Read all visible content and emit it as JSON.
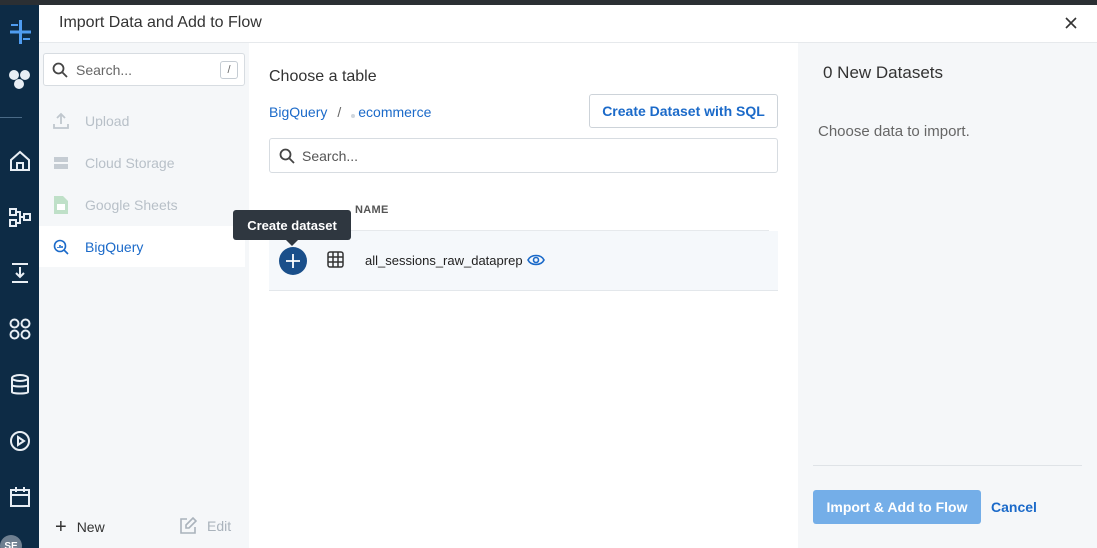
{
  "modal": {
    "title": "Import Data and Add to Flow"
  },
  "sidebar": {
    "search_placeholder": "Search...",
    "search_shortcut": "/",
    "items": [
      {
        "label": "Upload",
        "icon": "upload-icon",
        "state": "disabled"
      },
      {
        "label": "Cloud Storage",
        "icon": "cloud-storage-icon",
        "state": "disabled"
      },
      {
        "label": "Google Sheets",
        "icon": "google-sheets-icon",
        "state": "disabled"
      },
      {
        "label": "BigQuery",
        "icon": "bigquery-icon",
        "state": "active"
      }
    ],
    "new_label": "New",
    "edit_label": "Edit"
  },
  "main": {
    "section_title": "Choose a table",
    "breadcrumb": {
      "root": "BigQuery",
      "separator": "/",
      "dataset": "ecommerce"
    },
    "create_sql_label": "Create Dataset with SQL",
    "table_search_placeholder": "Search...",
    "column_header": "NAME",
    "rows": [
      {
        "name": "all_sessions_raw_dataprep"
      }
    ],
    "tooltip": "Create dataset"
  },
  "right_panel": {
    "title": "0 New Datasets",
    "message": "Choose data to import.",
    "import_label": "Import & Add to Flow",
    "cancel_label": "Cancel"
  },
  "user": {
    "initials": "SE"
  },
  "colors": {
    "rail": "#0d2b45",
    "accent": "#1b6ac9",
    "primary_button": "#74aee8",
    "add_button": "#1a4f8a"
  }
}
